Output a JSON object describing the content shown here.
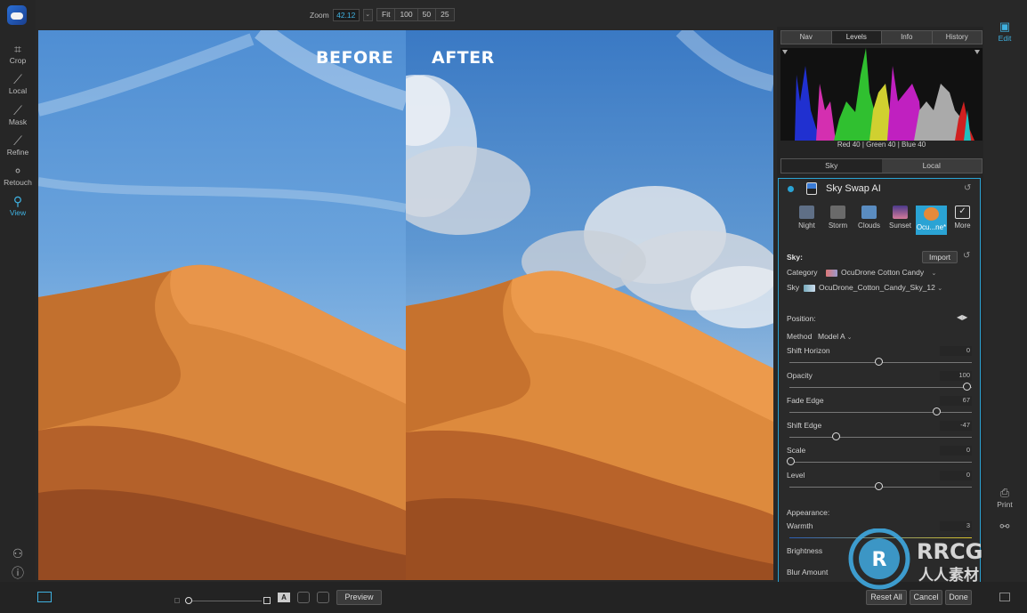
{
  "top": {
    "zoom_label": "Zoom",
    "zoom_value": "42.12",
    "zoom_presets": [
      "Fit",
      "100",
      "50",
      "25"
    ]
  },
  "left_tools": [
    {
      "label": "Crop",
      "icon": "crop-icon"
    },
    {
      "label": "Local",
      "icon": "brush-icon"
    },
    {
      "label": "Mask",
      "icon": "mask-brush-icon"
    },
    {
      "label": "Refine",
      "icon": "refine-brush-icon"
    },
    {
      "label": "Retouch",
      "icon": "retouch-icon"
    },
    {
      "label": "View",
      "icon": "view-zoom-icon",
      "active": true
    }
  ],
  "canvas": {
    "before_label": "BEFORE",
    "after_label": "AFTER"
  },
  "histogram": {
    "tabs": [
      "Nav",
      "Levels",
      "Info",
      "History"
    ],
    "active_tab": "Levels",
    "readout": "Red  40  | Green  40  | Blue  40"
  },
  "mode_tabs": [
    "Sky",
    "Local"
  ],
  "sky_panel": {
    "title": "Sky Swap AI",
    "presets": [
      {
        "label": "Night",
        "color": "#5f6f86"
      },
      {
        "label": "Storm",
        "color": "#6a6a6a"
      },
      {
        "label": "Clouds",
        "color": "#5a8cc0"
      },
      {
        "label": "Sunset",
        "color": "#b45d86"
      },
      {
        "label": "Ocu...ne*",
        "color": "#e58a3a",
        "active": true
      },
      {
        "label": "More",
        "color": "#2a2a2a"
      }
    ],
    "sky_label": "Sky:",
    "import_label": "Import",
    "category_label": "Category",
    "category_value": "OcuDrone Cotton Candy",
    "sky_row_label": "Sky",
    "sky_value": "OcuDrone_Cotton_Candy_Sky_12",
    "position_label": "Position:",
    "method_label": "Method",
    "method_value": "Model A",
    "sliders": [
      {
        "label": "Shift Horizon",
        "value": "0",
        "level": 0.5
      },
      {
        "label": "Opacity",
        "value": "100",
        "level": 1.0
      },
      {
        "label": "Fade Edge",
        "value": "67",
        "level": 0.83
      },
      {
        "label": "Shift Edge",
        "value": "-47",
        "level": 0.26
      },
      {
        "label": "Scale",
        "value": "0",
        "level": 0.0
      },
      {
        "label": "Level",
        "value": "0",
        "level": 0.5
      }
    ],
    "appearance_label": "Appearance:",
    "warmth_label": "Warmth",
    "warmth_value": "3",
    "brightness_label": "Brightness",
    "blur_label": "Blur Amount",
    "blur_value": "0"
  },
  "right_tools": [
    {
      "label": "Edit",
      "icon": "image-edit-icon",
      "active": true
    },
    {
      "label": "Print",
      "icon": "printer-icon"
    }
  ],
  "bottom": {
    "preview_label": "Preview",
    "reset_all_label": "Reset All",
    "cancel_label": "Cancel",
    "done_label": "Done"
  },
  "watermark": {
    "text": "RRCG",
    "subtext": "人人素材"
  }
}
